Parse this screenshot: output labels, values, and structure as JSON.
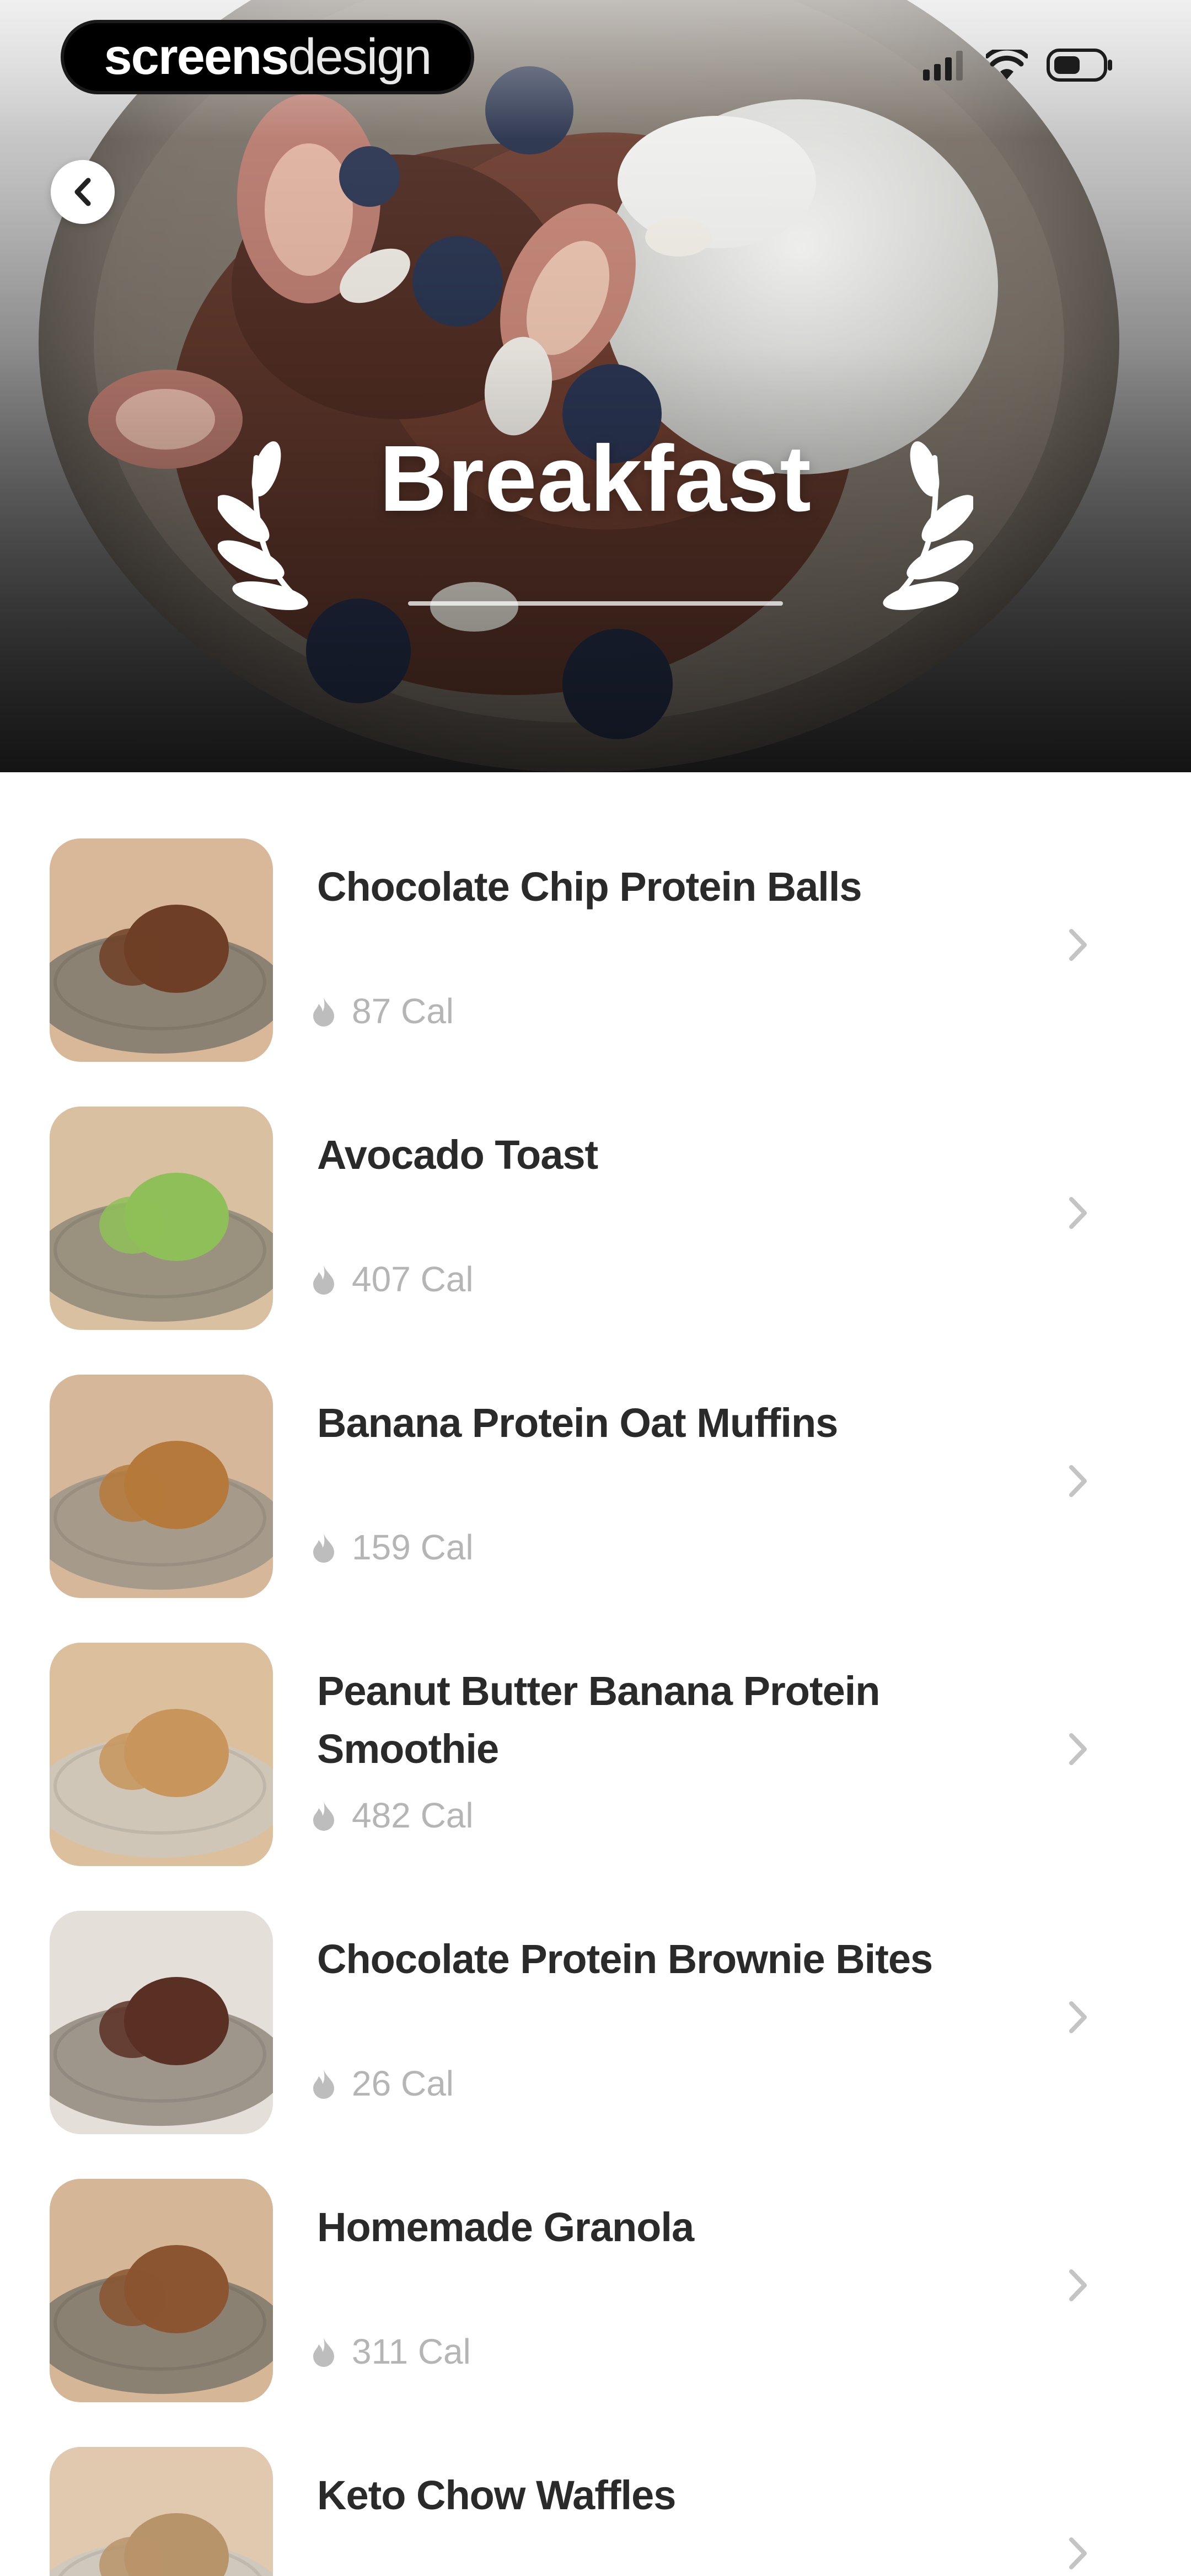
{
  "app": {
    "brand_bold": "screens",
    "brand_light": "design"
  },
  "header": {
    "title": "Breakfast",
    "back_icon": "chevron-left-icon"
  },
  "status_bar": {
    "icons": [
      "signal-icon",
      "wifi-icon",
      "battery-icon"
    ]
  },
  "colors": {
    "text_primary": "#2a2a2a",
    "text_muted": "#b5b5b5",
    "background": "#ffffff"
  },
  "recipes": [
    {
      "name": "Chocolate Chip Protein Balls",
      "calories": "87 Cal",
      "icon": "flame-icon"
    },
    {
      "name": "Avocado Toast",
      "calories": "407 Cal",
      "icon": "flame-icon"
    },
    {
      "name": "Banana Protein Oat Muffins",
      "calories": "159 Cal",
      "icon": "flame-icon"
    },
    {
      "name": "Peanut Butter Banana Protein Smoothie",
      "calories": "482 Cal",
      "icon": "flame-icon"
    },
    {
      "name": "Chocolate Protein Brownie Bites",
      "calories": "26 Cal",
      "icon": "flame-icon"
    },
    {
      "name": "Homemade Granola",
      "calories": "311 Cal",
      "icon": "flame-icon"
    },
    {
      "name": "Keto Chow Waffles",
      "calories": "",
      "icon": "flame-icon"
    }
  ]
}
